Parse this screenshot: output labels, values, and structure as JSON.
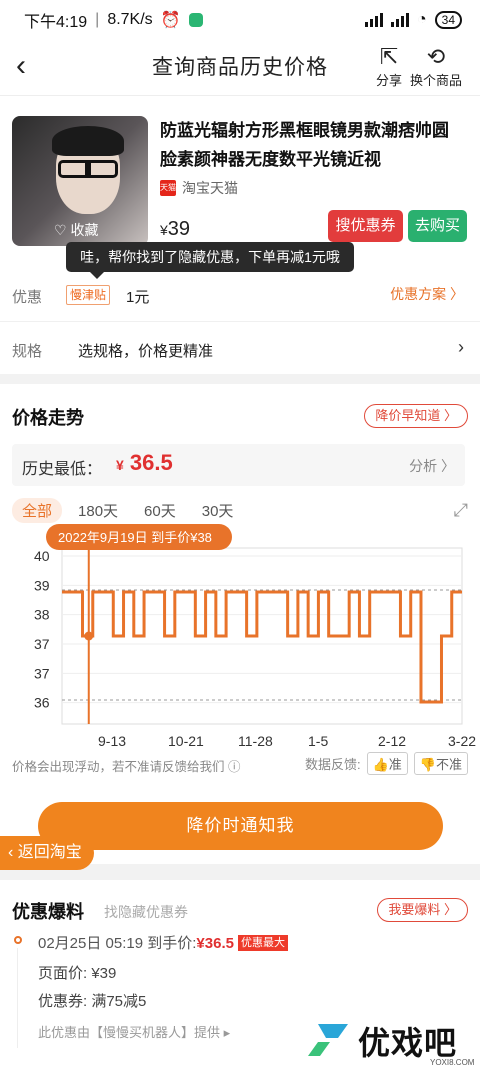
{
  "status_bar": {
    "time": "下午4:19",
    "net_speed": "8.7K/s",
    "battery": "34"
  },
  "nav": {
    "title": "查询商品历史价格",
    "share_label": "分享",
    "switch_label": "换个商品"
  },
  "product": {
    "title": "防蓝光辐射方形黑框眼镜男款潮痞帅圆脸素颜神器无度数平光镜近视",
    "shop": "淘宝天猫",
    "shop_logo": "天猫",
    "price_symbol": "¥",
    "price": "39",
    "fav_label": "收藏",
    "coupon_button": "搜优惠券",
    "buy_button": "去购买"
  },
  "tooltip": "哇，帮你找到了隐藏优惠，下单再减1元哦",
  "discount_row": {
    "label": "优惠",
    "tag": "慢津贴",
    "value": "1元",
    "link": "优惠方案 〉"
  },
  "spec_row": {
    "label": "规格",
    "value": "选规格，价格更精准"
  },
  "trend": {
    "title": "价格走势",
    "notify_pill": "降价早知道 〉",
    "lowest_label": "历史最低：",
    "lowest_symbol": "¥",
    "lowest_value": "36.5",
    "analyze_link": "分析 〉",
    "ranges": [
      "全部",
      "180天",
      "60天",
      "30天"
    ],
    "active_range": "全部",
    "feedback_text": "价格会出现浮动，若不准请反馈给我们",
    "feedback_label": "数据反馈:",
    "accurate_label": "准",
    "inaccurate_label": "不准",
    "notify_button": "降价时通知我",
    "back_taobao": "返回淘宝"
  },
  "chart_data": {
    "type": "line",
    "title": "",
    "xlabel": "",
    "ylabel": "",
    "y_tick_labels": [
      "40",
      "39",
      "38",
      "37",
      "37",
      "36"
    ],
    "x_tick_labels": [
      "9-13",
      "10-21",
      "11-28",
      "1-5",
      "2-12",
      "3-22"
    ],
    "ylim": [
      36,
      40
    ],
    "callout": "2022年9月19日 到手价¥38",
    "highlight_date": "2022-09-19",
    "highlight_value": 38,
    "series": [
      {
        "values": [
          39,
          39,
          38,
          39,
          39,
          38,
          39,
          38,
          39,
          39,
          38,
          39,
          39,
          38,
          39,
          38,
          39,
          39,
          38,
          39,
          39,
          39,
          38,
          39,
          38,
          39,
          38,
          38,
          39,
          38,
          39,
          39,
          39,
          38,
          39,
          36.5,
          36.5,
          38,
          39,
          39
        ]
      }
    ],
    "color": "#e8732a"
  },
  "deals": {
    "title": "优惠爆料",
    "subtitle": "找隐藏优惠券",
    "pill": "我要爆料 〉",
    "item": {
      "time": "02月25日 05:19",
      "price_prefix": "到手价:",
      "price": "¥36.5",
      "badge": "优惠最大",
      "page_price": "页面价: ¥39",
      "coupon": "优惠券:  满75减5",
      "source": "此优惠由【慢慢买机器人】提供 ▸"
    }
  },
  "watermark": {
    "text": "优戏吧",
    "url": "YOXI8.COM"
  },
  "colors": {
    "accent": "#e8732a",
    "price_red": "#e03030",
    "coupon_red": "#e23c3c",
    "buy_green": "#2ab06f"
  }
}
